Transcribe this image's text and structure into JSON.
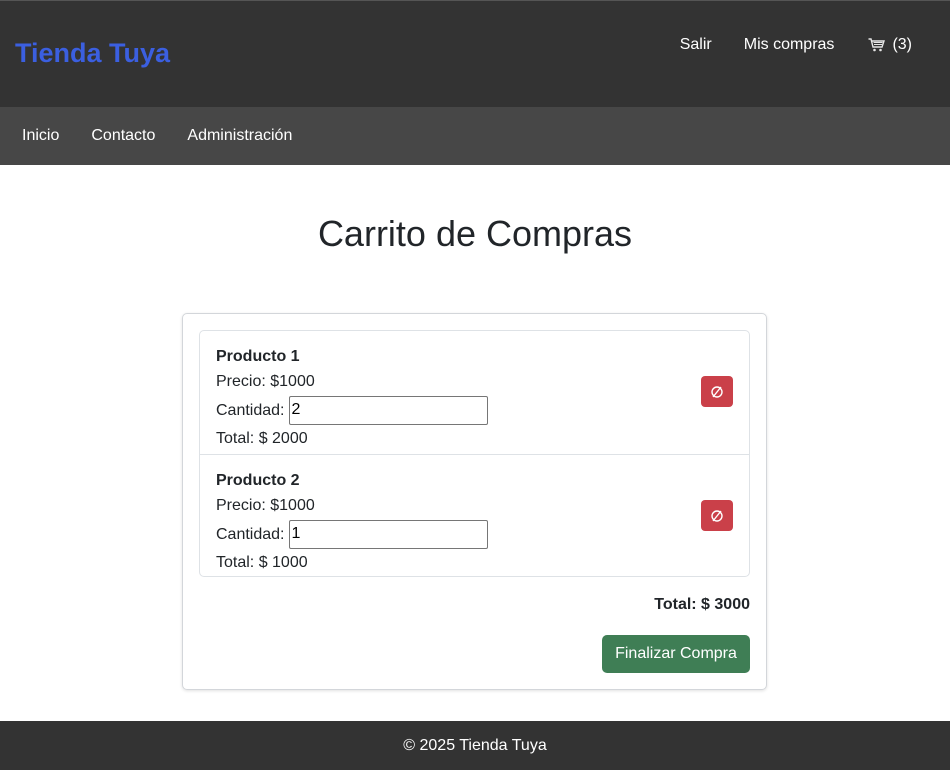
{
  "header": {
    "brand": "Tienda Tuya",
    "links": {
      "logout": "Salir",
      "orders": "Mis compras"
    },
    "cart": {
      "count_label": "(3)",
      "icon": "shopping-cart-icon"
    }
  },
  "nav": {
    "items": [
      "Inicio",
      "Contacto",
      "Administración"
    ]
  },
  "page": {
    "title": "Carrito de Compras"
  },
  "cart": {
    "items": [
      {
        "name": "Producto 1",
        "price_text": "Precio: $1000",
        "qty_label": "Cantidad:",
        "qty": "2",
        "total_text": "Total: $ 2000",
        "delete_icon": "empty-set-icon"
      },
      {
        "name": "Producto 2",
        "price_text": "Precio: $1000",
        "qty_label": "Cantidad:",
        "qty": "1",
        "total_text": "Total: $ 1000",
        "delete_icon": "empty-set-icon"
      }
    ],
    "grand_total": "Total: $ 3000",
    "checkout_label": "Finalizar Compra"
  },
  "colors": {
    "brand": "#3b5fe0",
    "delete": "#ca4049",
    "checkout": "#3f7e55",
    "topbar": "#333333",
    "navbar": "#474747"
  },
  "footer": {
    "text": "© 2025 Tienda Tuya"
  }
}
